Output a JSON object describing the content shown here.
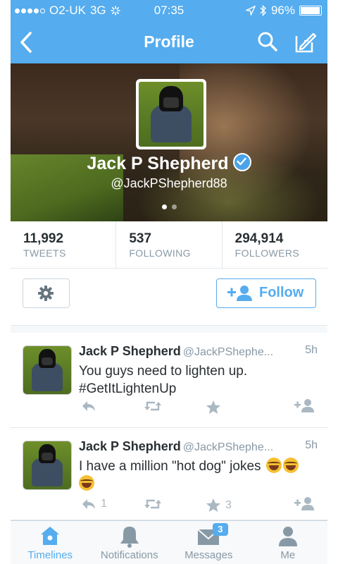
{
  "status_bar": {
    "carrier": "O2-UK",
    "network": "3G",
    "time": "07:35",
    "battery": "96%",
    "battery_level": 0.96,
    "signal_bars": 4
  },
  "nav": {
    "title": "Profile",
    "back_icon": "chevron-left-icon",
    "search_icon": "search-icon",
    "compose_icon": "compose-icon"
  },
  "profile": {
    "name": "Jack P Shepherd",
    "handle": "@JackPShepherd88",
    "verified": true,
    "pager_pages": 2,
    "pager_active": 0
  },
  "stats": [
    {
      "value": "11,992",
      "label": "TWEETS"
    },
    {
      "value": "537",
      "label": "FOLLOWING"
    },
    {
      "value": "294,914",
      "label": "FOLLOWERS"
    }
  ],
  "actions": {
    "follow_label": "Follow"
  },
  "tweets": [
    {
      "name": "Jack P Shepherd",
      "handle": "@JackPShephe...",
      "time": "5h",
      "text": "You guys need to lighten up. #GetItLightenUp",
      "reply_count": "",
      "retweet_count": "",
      "favorite_count": ""
    },
    {
      "name": "Jack P Shepherd",
      "handle": "@JackPShephe...",
      "time": "5h",
      "text": "I have a million \"hot dog\" jokes",
      "reply_count": "1",
      "retweet_count": "",
      "favorite_count": "3"
    }
  ],
  "tabs": [
    {
      "label": "Timelines",
      "icon": "home-icon",
      "active": true
    },
    {
      "label": "Notifications",
      "icon": "bell-icon",
      "active": false
    },
    {
      "label": "Messages",
      "icon": "envelope-icon",
      "badge": "3",
      "active": false
    },
    {
      "label": "Me",
      "icon": "person-icon",
      "active": false
    }
  ],
  "colors": {
    "brand": "#55acee",
    "text": "#292f33",
    "muted": "#8899a6"
  }
}
